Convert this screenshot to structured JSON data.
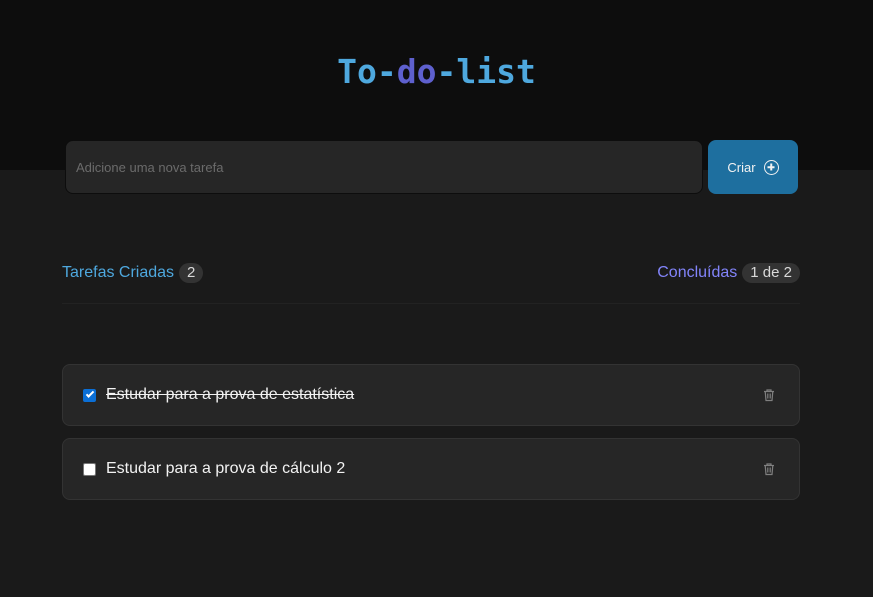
{
  "header": {
    "title_part1": "To-",
    "title_part2": "do",
    "title_part3": "-list"
  },
  "new_task": {
    "placeholder": "Adicione uma nova tarefa",
    "value": "",
    "create_label": "Criar",
    "create_icon": "plus-circle-icon"
  },
  "counters": {
    "created_label": "Tarefas Criadas",
    "created_count": "2",
    "done_label": "Concluídas",
    "done_count": "1 de 2"
  },
  "tasks": [
    {
      "text": "Estudar para a prova de estatística",
      "done": true
    },
    {
      "text": "Estudar para a prova de cálculo 2",
      "done": false
    }
  ],
  "colors": {
    "blue": "#4ea8de",
    "purple": "#5e60ce",
    "button": "#1e6f9f",
    "background": "#1a1a1a",
    "header_background": "#0d0d0d"
  }
}
